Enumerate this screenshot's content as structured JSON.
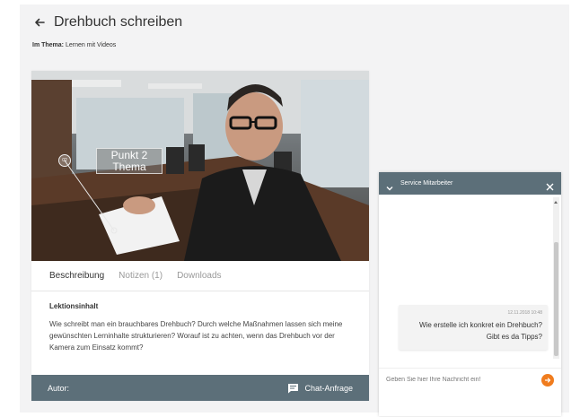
{
  "header": {
    "title": "Drehbuch schreiben",
    "topic_label": "Im Thema:",
    "topic_value": "Lernen mit Videos"
  },
  "video": {
    "overlay_line1": "Punkt 2",
    "overlay_line2": "Thema",
    "marker_label": "02"
  },
  "tabs": [
    {
      "label": "Beschreibung",
      "active": true
    },
    {
      "label": "Notizen (1)",
      "active": false
    },
    {
      "label": "Downloads",
      "active": false
    }
  ],
  "content": {
    "heading": "Lektionsinhalt",
    "text": "Wie schreibt man ein brauchbares Drehbuch? Durch welche Maßnahmen lassen sich meine gewünschten Lerninhalte strukturieren? Worauf ist zu achten, wenn das Drehbuch vor der Kamera zum Einsatz kommt?"
  },
  "footer": {
    "author_label": "Autor:",
    "chat_button_label": "Chat-Anfrage"
  },
  "chat": {
    "title": "Service Mitarbeiter",
    "message": {
      "timestamp": "12.11.2018 10:48",
      "line1": "Wie erstelle ich konkret ein Drehbuch?",
      "line2": "Gibt es da Tipps?"
    },
    "input_placeholder": "Geben Sie hier Ihre Nachricht ein!"
  },
  "colors": {
    "accent_bar": "#5c6f79",
    "send_button": "#f07c1e",
    "page_background": "#f3f3f4"
  }
}
